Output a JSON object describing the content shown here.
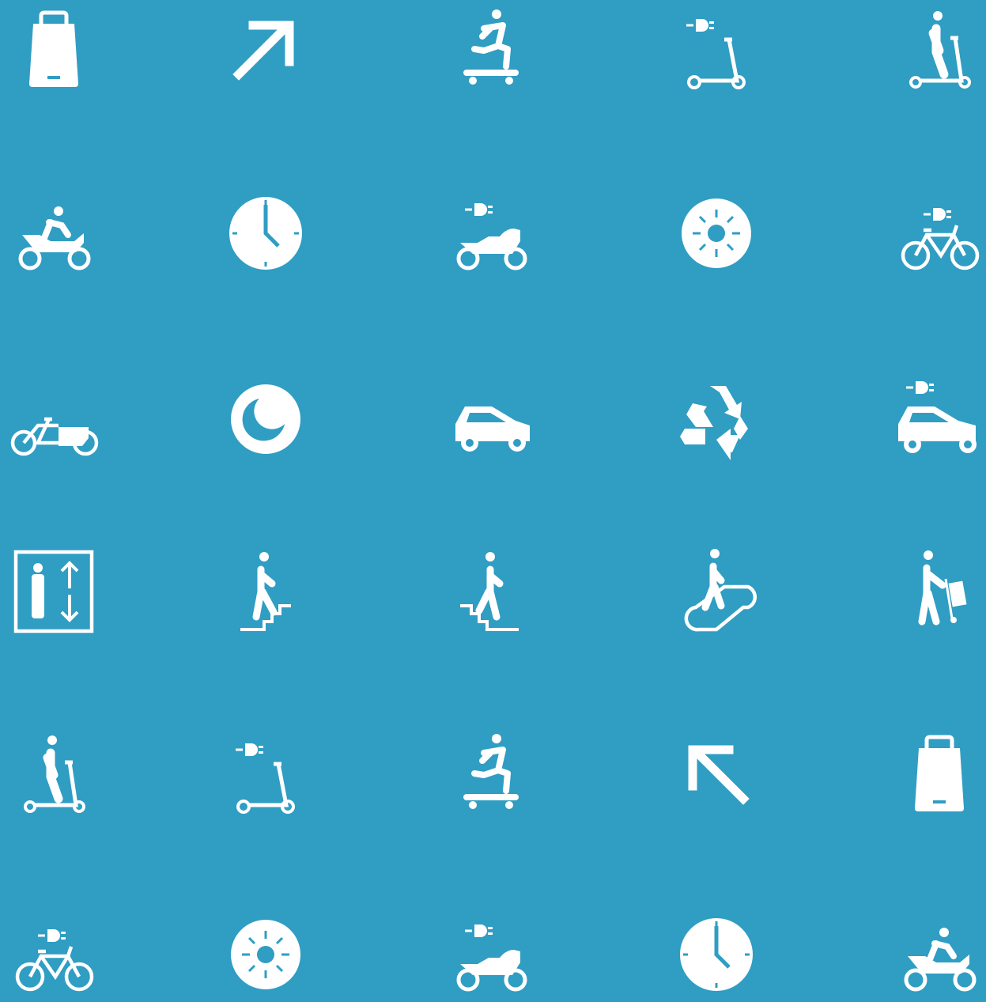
{
  "colors": {
    "background": "#309dc3",
    "icon": "#ffffff"
  },
  "icons": [
    [
      "shopping-bag-icon",
      "arrow-up-right-icon",
      "skateboarder-icon",
      "electric-kick-scooter-icon",
      "person-kick-scooter-icon"
    ],
    [
      "motorcycle-rider-icon",
      "clock-icon",
      "electric-motorcycle-icon",
      "sun-icon",
      "electric-bicycle-icon"
    ],
    [
      "cargo-bike-icon",
      "moon-icon",
      "car-icon",
      "recycle-icon",
      "electric-car-icon"
    ],
    [
      "elevator-icon",
      "stairs-up-icon",
      "stairs-down-icon",
      "escalator-icon",
      "person-trolley-icon"
    ],
    [
      "person-kick-scooter-icon",
      "electric-kick-scooter-icon",
      "skateboarder-icon",
      "arrow-up-left-icon",
      "shopping-bag-icon"
    ],
    [
      "electric-bicycle-icon",
      "sun-icon",
      "electric-motorcycle-icon",
      "clock-icon",
      "motorcycle-rider-icon"
    ]
  ]
}
